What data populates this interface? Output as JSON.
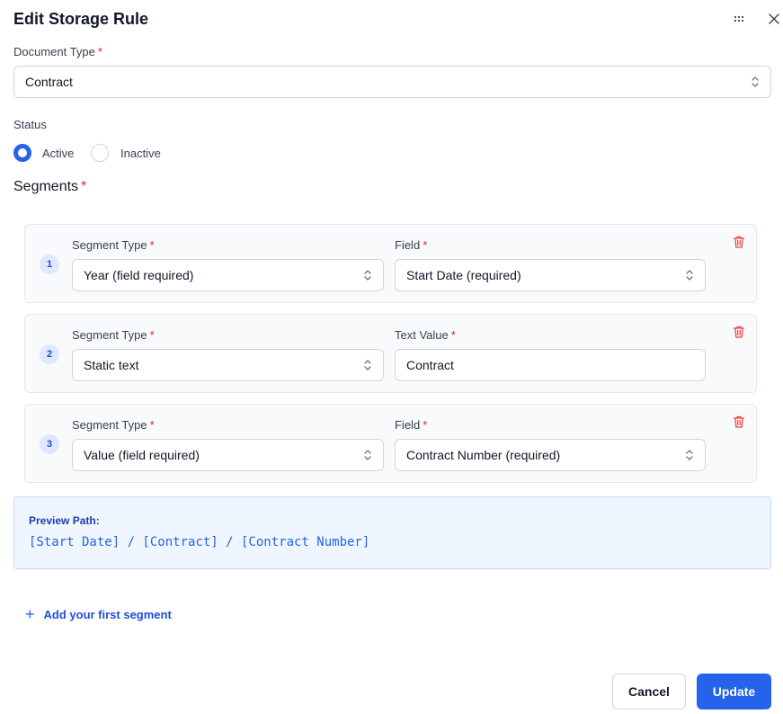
{
  "header": {
    "title": "Edit Storage Rule",
    "menu_icon": "more-dots-icon",
    "close_icon": "close-icon"
  },
  "required_marker": "*",
  "document_type": {
    "label": "Document Type",
    "value": "Contract"
  },
  "status": {
    "label": "Status",
    "options": [
      "Active",
      "Inactive"
    ],
    "selected": "Active"
  },
  "segments": {
    "title": "Segments",
    "items": [
      {
        "number": "1",
        "type_label": "Segment Type",
        "type_value": "Year (field required)",
        "field_label": "Field",
        "field_value": "Start Date (required)"
      },
      {
        "number": "2",
        "type_label": "Segment Type",
        "type_value": "Static text",
        "field_label": "Text Value",
        "field_value": "Contract"
      },
      {
        "number": "3",
        "type_label": "Segment Type",
        "type_value": "Value (field required)",
        "field_label": "Field",
        "field_value": "Contract Number (required)"
      }
    ]
  },
  "preview": {
    "label": "Preview Path:",
    "path": "[Start Date] / [Contract] / [Contract Number]"
  },
  "add_segment": {
    "label": "Add your first segment",
    "icon": "plus-icon"
  },
  "footer": {
    "cancel_label": "Cancel",
    "update_label": "Update"
  },
  "colors": {
    "accent": "#2563eb",
    "required": "#dc2626",
    "delete": "#ef4444",
    "preview_bg": "#eff6ff"
  }
}
